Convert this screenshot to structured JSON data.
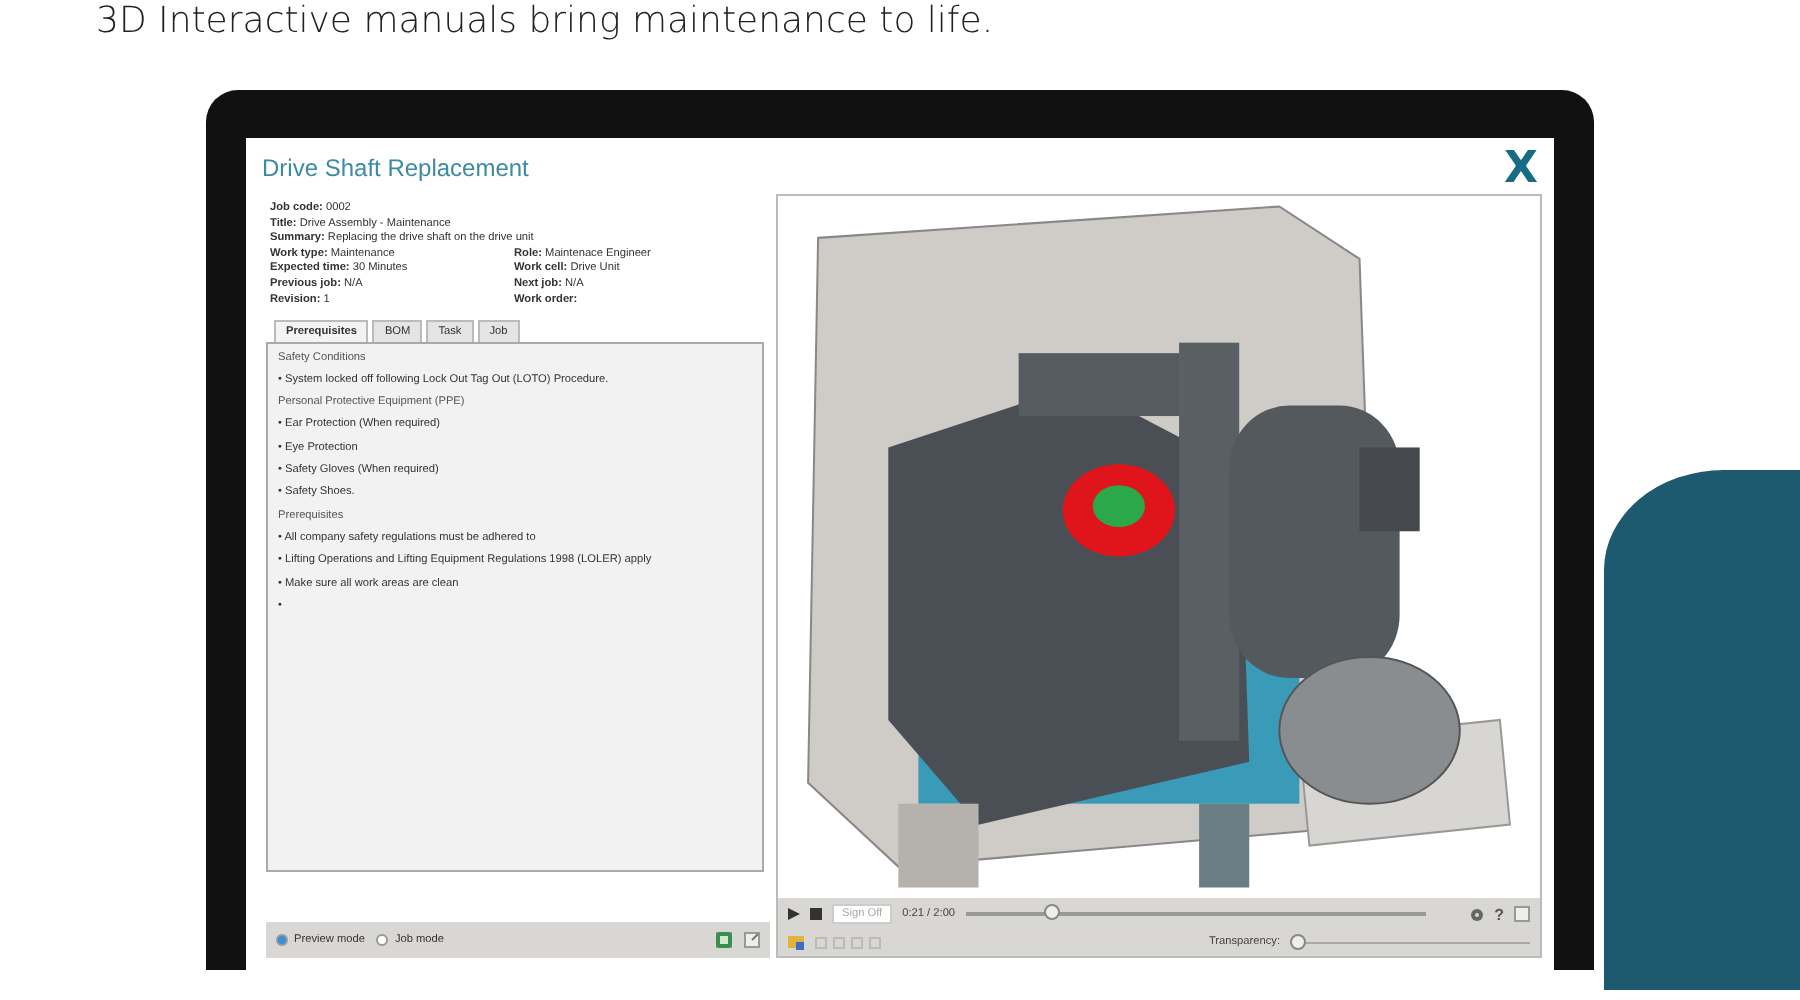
{
  "headline": "3D Interactive manuals bring maintenance to life.",
  "app": {
    "title": "Drive Shaft Replacement",
    "logo": "X"
  },
  "details_full": [
    {
      "label": "Job code:",
      "value": "0002"
    },
    {
      "label": "Title:",
      "value": "Drive Assembly - Maintenance"
    },
    {
      "label": "Summary:",
      "value": "Replacing the drive shaft on the drive unit"
    }
  ],
  "details_left": [
    {
      "label": "Work type:",
      "value": "Maintenance"
    },
    {
      "label": "Expected time:",
      "value": "30 Minutes"
    },
    {
      "label": "Previous job:",
      "value": "N/A"
    },
    {
      "label": "Revision:",
      "value": "1"
    }
  ],
  "details_right": [
    {
      "label": "Role:",
      "value": "Maintenace Engineer"
    },
    {
      "label": "Work cell:",
      "value": "Drive Unit"
    },
    {
      "label": "Next job:",
      "value": "N/A"
    },
    {
      "label": "Work order:"
    }
  ],
  "tabs": [
    {
      "label": "Prerequisites",
      "selected": true
    },
    {
      "label": "BOM",
      "selected": false
    },
    {
      "label": "Task",
      "selected": false
    },
    {
      "label": "Job",
      "selected": false
    }
  ],
  "content": [
    {
      "kind": "heading",
      "text": "Safety Conditions"
    },
    {
      "kind": "bullet",
      "text": "• System locked off following Lock Out Tag Out (LOTO) Procedure."
    },
    {
      "kind": "heading",
      "text": "Personal Protective Equipment (PPE)"
    },
    {
      "kind": "bullet",
      "text": "• Ear Protection (When required)"
    },
    {
      "kind": "bullet",
      "text": "• Eye Protection"
    },
    {
      "kind": "bullet",
      "text": "• Safety Gloves (When required)"
    },
    {
      "kind": "bullet",
      "text": "• Safety Shoes."
    },
    {
      "kind": "heading",
      "text": "Prerequisites"
    },
    {
      "kind": "bullet",
      "text": "• All company safety regulations must be adhered to"
    },
    {
      "kind": "bullet",
      "text": "• Lifting Operations and Lifting Equipment Regulations 1998 (LOLER) apply"
    },
    {
      "kind": "bullet",
      "text": "• Make sure all work areas are clean"
    },
    {
      "kind": "bullet",
      "text": "•"
    }
  ],
  "modes": [
    {
      "label": "Preview mode",
      "selected": true
    },
    {
      "label": "Job mode",
      "selected": false
    }
  ],
  "player": {
    "sign_off": "Sign Off",
    "time": "0:21 / 2:00",
    "level": 0.19,
    "help": "?",
    "transparency_label": "Transparency:",
    "transparency": {
      "level": 0
    }
  }
}
